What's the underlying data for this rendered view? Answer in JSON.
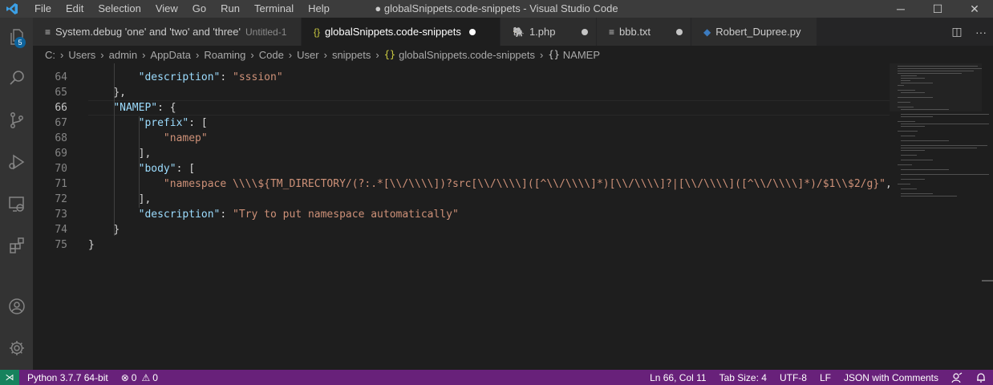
{
  "window": {
    "title": "● globalSnippets.code-snippets - Visual Studio Code",
    "controls": {
      "minimize": "─",
      "maximize": "☐",
      "close": "✕"
    }
  },
  "menu": [
    "File",
    "Edit",
    "Selection",
    "View",
    "Go",
    "Run",
    "Terminal",
    "Help"
  ],
  "activity": {
    "explorer_badge": "5"
  },
  "tabs": [
    {
      "icon": "≡",
      "label": "System.debug 'one' and 'two' and 'three'",
      "description": "Untitled-1"
    },
    {
      "icon": "{}",
      "label": "globalSnippets.code-snippets"
    },
    {
      "icon": "🐘",
      "label": "1.php"
    },
    {
      "icon": "≡",
      "label": "bbb.txt"
    },
    {
      "icon": "◆",
      "label": "Robert_Dupree.py"
    }
  ],
  "tab_actions": {
    "split": "◫",
    "more": "···"
  },
  "breadcrumb": {
    "parts": [
      "C:",
      "Users",
      "admin",
      "AppData",
      "Roaming",
      "Code",
      "User",
      "snippets"
    ],
    "file_icon": "{}",
    "file": "globalSnippets.code-snippets",
    "symbol_icon": "{}",
    "symbol": "NAMEP"
  },
  "editor": {
    "lines": [
      {
        "num": "64",
        "indent": "        ",
        "key": "\"description\"",
        "rest": ": ",
        "str": "\"sssion\"",
        "tail": ""
      },
      {
        "num": "65",
        "indent": "    ",
        "key": "",
        "rest": "},",
        "str": "",
        "tail": ""
      },
      {
        "num": "66",
        "indent": "    ",
        "key": "\"NAMEP\"",
        "rest": ": {",
        "str": "",
        "tail": ""
      },
      {
        "num": "67",
        "indent": "        ",
        "key": "\"prefix\"",
        "rest": ": [",
        "str": "",
        "tail": ""
      },
      {
        "num": "68",
        "indent": "            ",
        "key": "",
        "rest": "",
        "str": "\"namep\"",
        "tail": ""
      },
      {
        "num": "69",
        "indent": "        ",
        "key": "",
        "rest": "],",
        "str": "",
        "tail": ""
      },
      {
        "num": "70",
        "indent": "        ",
        "key": "\"body\"",
        "rest": ": [",
        "str": "",
        "tail": ""
      },
      {
        "num": "71",
        "indent": "            ",
        "key": "",
        "rest": "",
        "str": "\"namespace \\\\\\\\${TM_DIRECTORY/(?:.*[\\\\/\\\\\\\\])?src[\\\\/\\\\\\\\]([^\\\\/\\\\\\\\]*)[\\\\/\\\\\\\\]?|[\\\\/\\\\\\\\]([^\\\\/\\\\\\\\]*)/$1\\\\$2/g}\"",
        "tail": ","
      },
      {
        "num": "72",
        "indent": "        ",
        "key": "",
        "rest": "],",
        "str": "",
        "tail": ""
      },
      {
        "num": "73",
        "indent": "        ",
        "key": "\"description\"",
        "rest": ": ",
        "str": "\"Try to put namespace automatically\"",
        "tail": ""
      },
      {
        "num": "74",
        "indent": "    ",
        "key": "",
        "rest": "}",
        "str": "",
        "tail": ""
      },
      {
        "num": "75",
        "indent": "",
        "key": "",
        "rest": "}",
        "str": "",
        "tail": ""
      }
    ],
    "current_line": "66"
  },
  "status": {
    "remote_icon": "⋊",
    "python": "Python 3.7.7 64-bit",
    "errors": "0",
    "warnings": "0",
    "position": "Ln 66, Col 11",
    "tab_size": "Tab Size: 4",
    "encoding": "UTF-8",
    "eol": "LF",
    "language": "JSON with Comments"
  },
  "colors": {
    "titlebar": "#3c3c3c",
    "activitybar": "#333333",
    "editor_bg": "#1e1e1e",
    "statusbar": "#68217a",
    "key": "#9cdcfe",
    "string": "#ce9178"
  }
}
